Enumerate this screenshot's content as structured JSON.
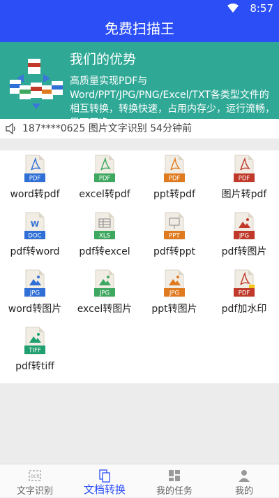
{
  "status": {
    "time": "8:57"
  },
  "app": {
    "title": "免费扫描王"
  },
  "banner": {
    "heading": "我们的优势",
    "description": "高质量实现PDF与Word/PPT/JPG/PNG/Excel/TXT各类型文件的相互转换，转换快速，占用内存少，运行流畅，界面干净"
  },
  "notice": {
    "text": "187****0625  图片文字识别  54分钟前"
  },
  "tools": [
    {
      "label": "word转pdf",
      "badge": "PDF",
      "color": "#2f6fd6",
      "icon": "pdf-file-icon"
    },
    {
      "label": "excel转pdf",
      "badge": "PDF",
      "color": "#3fa860",
      "icon": "pdf-file-icon"
    },
    {
      "label": "ppt转pdf",
      "badge": "PDF",
      "color": "#e07a1f",
      "icon": "pdf-file-icon"
    },
    {
      "label": "图片转pdf",
      "badge": "PDF",
      "color": "#c0392b",
      "icon": "pdf-file-icon"
    },
    {
      "label": "pdf转word",
      "badge": "DOC",
      "color": "#2f6fd6",
      "icon": "word-file-icon"
    },
    {
      "label": "pdf转excel",
      "badge": "XLS",
      "color": "#3fa860",
      "icon": "excel-file-icon"
    },
    {
      "label": "pdf转ppt",
      "badge": "PPT",
      "color": "#e07a1f",
      "icon": "ppt-file-icon"
    },
    {
      "label": "pdf转图片",
      "badge": "JPG",
      "color": "#c0392b",
      "icon": "image-file-icon"
    },
    {
      "label": "word转图片",
      "badge": "JPG",
      "color": "#2f6fd6",
      "icon": "image-file-icon"
    },
    {
      "label": "excel转图片",
      "badge": "JPG",
      "color": "#3fa860",
      "icon": "image-file-icon"
    },
    {
      "label": "ppt转图片",
      "badge": "JPG",
      "color": "#e07a1f",
      "icon": "image-file-icon"
    },
    {
      "label": "pdf加水印",
      "badge": "PDF",
      "color": "#c0392b",
      "icon": "watermark-file-icon"
    },
    {
      "label": "pdf转tiff",
      "badge": "TIFF",
      "color": "#1f9e6e",
      "icon": "tiff-file-icon"
    }
  ],
  "nav": [
    {
      "label": "文字识别",
      "icon": "ocr-icon",
      "active": false
    },
    {
      "label": "文档转换",
      "icon": "documents-icon",
      "active": true
    },
    {
      "label": "我的任务",
      "icon": "tasks-grid-icon",
      "active": false
    },
    {
      "label": "我的",
      "icon": "profile-icon",
      "active": false
    }
  ],
  "colors": {
    "primary": "#2b4ef6",
    "banner": "#2fa896"
  }
}
